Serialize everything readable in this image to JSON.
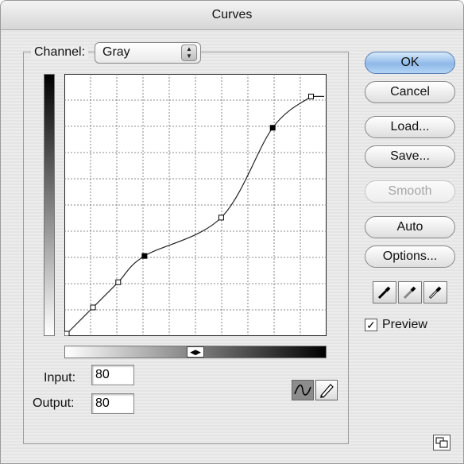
{
  "window": {
    "title": "Curves"
  },
  "channel": {
    "label": "Channel:",
    "value": "Gray"
  },
  "curve": {
    "input_range": [
      0,
      255
    ],
    "output_range": [
      0,
      255
    ],
    "points": [
      [
        0,
        0
      ],
      [
        26,
        26
      ],
      [
        51,
        51
      ],
      [
        77,
        77
      ],
      [
        153,
        115
      ],
      [
        204,
        204
      ],
      [
        242,
        235
      ]
    ]
  },
  "fields": {
    "input_label": "Input:",
    "input_value": "80",
    "output_label": "Output:",
    "output_value": "80"
  },
  "buttons": {
    "ok": "OK",
    "cancel": "Cancel",
    "load": "Load...",
    "save": "Save...",
    "smooth": "Smooth",
    "auto": "Auto",
    "options": "Options..."
  },
  "preview": {
    "label": "Preview",
    "checked": true
  },
  "icons": {
    "channel_stepper": "up-down-arrows-icon",
    "black_eyedropper": "black-eyedropper-icon",
    "gray_eyedropper": "gray-eyedropper-icon",
    "white_eyedropper": "white-eyedropper-icon",
    "curve_tool": "curve-tool-icon",
    "pencil_tool": "pencil-tool-icon",
    "gradient_toggle": "gradient-toggle-icon",
    "resize": "resize-icon"
  }
}
